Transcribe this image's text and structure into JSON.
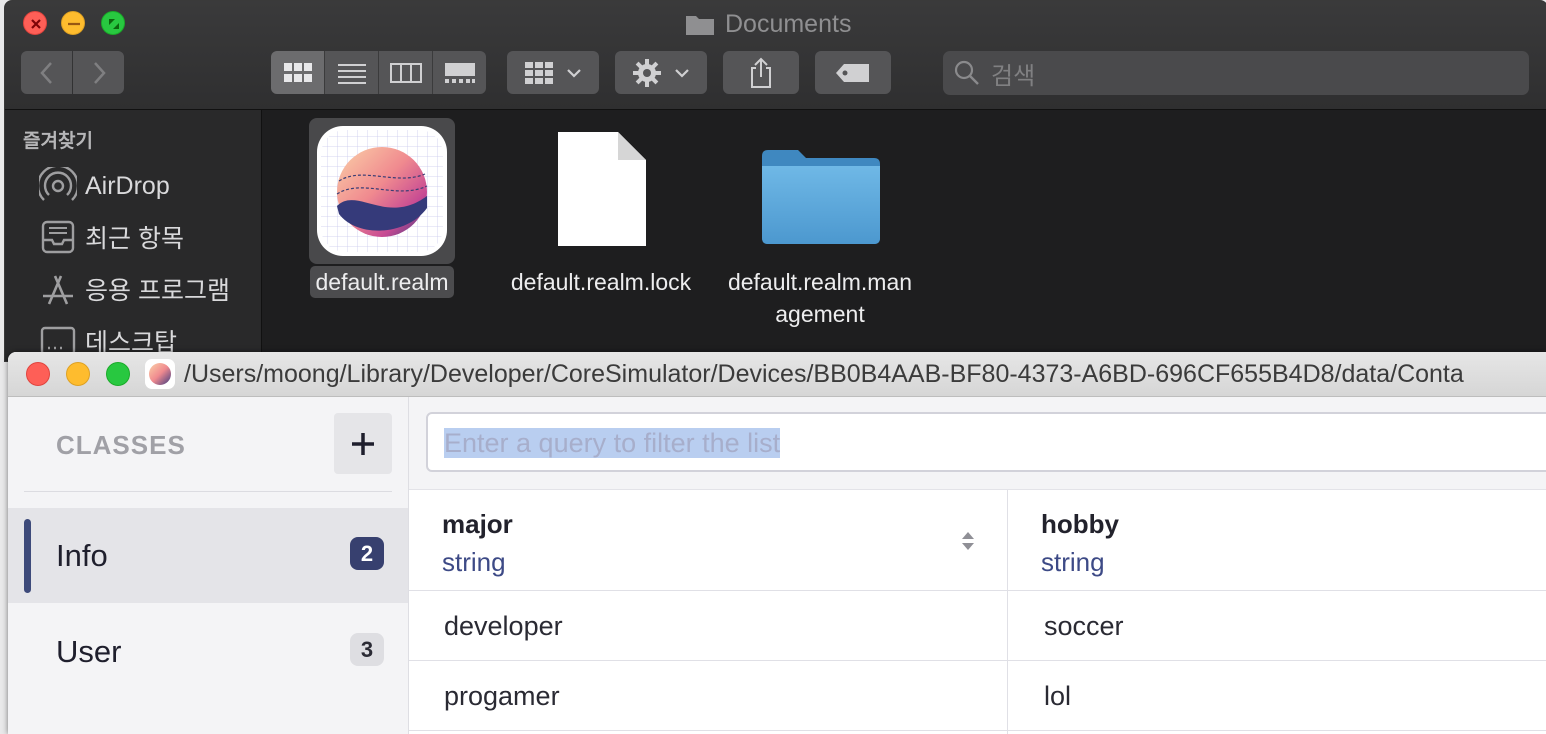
{
  "finder": {
    "title": "Documents",
    "search_placeholder": "검색",
    "sidebar": {
      "header": "즐겨찾기",
      "items": [
        {
          "label": "AirDrop",
          "icon": "airdrop-icon"
        },
        {
          "label": "최근 항목",
          "icon": "recents-icon"
        },
        {
          "label": "응용 프로그램",
          "icon": "applications-icon"
        },
        {
          "label": "데스크탑",
          "icon": "desktop-icon"
        }
      ]
    },
    "files": [
      {
        "name": "default.realm",
        "icon": "realm-file-icon",
        "selected": true
      },
      {
        "name": "default.realm.lock",
        "icon": "document-icon",
        "selected": false
      },
      {
        "name_line1": "default.realm.man",
        "name_line2": "agement",
        "icon": "folder-icon",
        "selected": false
      }
    ]
  },
  "realm": {
    "path": "/Users/moong/Library/Developer/CoreSimulator/Devices/BB0B4AAB-BF80-4373-A6BD-696CF655B4D8/data/Conta",
    "classes_title": "CLASSES",
    "add_label": "+",
    "classes": [
      {
        "name": "Info",
        "count": "2",
        "active": true
      },
      {
        "name": "User",
        "count": "3",
        "active": false
      }
    ],
    "query_placeholder": "Enter a query to filter the list",
    "columns": [
      {
        "title": "major",
        "type": "string"
      },
      {
        "title": "hobby",
        "type": "string"
      }
    ],
    "rows": [
      {
        "major": "developer",
        "hobby": "soccer"
      },
      {
        "major": "progamer",
        "hobby": "lol"
      }
    ],
    "colors": {
      "accent": "#37406f",
      "type_text": "#3d4a86",
      "selection": "#b9cef0"
    }
  }
}
